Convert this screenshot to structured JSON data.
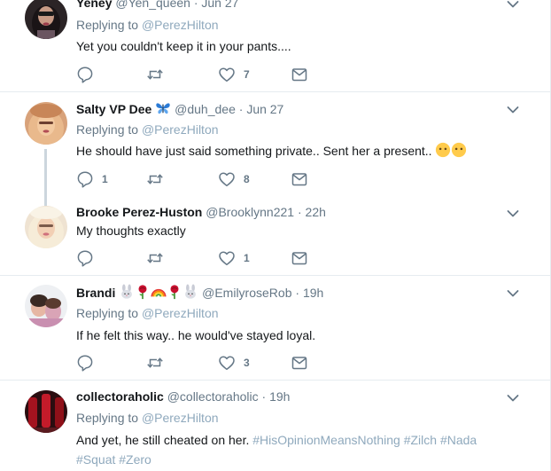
{
  "tweets": [
    {
      "name": "Yeney",
      "handle": "@Yen_queen",
      "time": "Jun 27",
      "replying_prefix": "Replying to",
      "replying_handle": "@PerezHilton",
      "text": "Yet you couldn't keep it in your pants....",
      "replies": "",
      "likes": "7"
    },
    {
      "name": "Salty VP Dee",
      "handle": "@duh_dee",
      "time": "Jun 27",
      "replying_prefix": "Replying to",
      "replying_handle": "@PerezHilton",
      "text": "He should have just said something private.. Sent her a present..",
      "replies": "1",
      "likes": "8",
      "name_emoji": [
        "butterfly"
      ],
      "text_emoji": [
        "no-mouth-face",
        "no-mouth-face"
      ]
    },
    {
      "name": "Brooke Perez-Huston",
      "handle": "@Brooklynn221",
      "time": "22h",
      "text": "My thoughts exactly",
      "replies": "",
      "likes": "1"
    },
    {
      "name": "Brandi",
      "handle": "@EmilyroseRob",
      "time": "19h",
      "replying_prefix": "Replying to",
      "replying_handle": "@PerezHilton",
      "text": "If he felt this way.. he would've stayed loyal.",
      "replies": "",
      "likes": "3",
      "name_emoji": [
        "rabbit",
        "rose",
        "rainbow",
        "rose",
        "rabbit"
      ]
    },
    {
      "name": "collectoraholic",
      "handle": "@collectoraholic",
      "time": "19h",
      "replying_prefix": "Replying to",
      "replying_handle": "@PerezHilton",
      "text": "And yet, he still cheated on her.",
      "hashtags": [
        "#HisOpinionMeansNothing",
        "#Zilch",
        "#Nada",
        "#Squat",
        "#Zero"
      ]
    }
  ],
  "separator": "·",
  "colors": {
    "text": "#14171a",
    "secondary": "#657786",
    "link": "#8fa9bd",
    "border": "#e6ecf0"
  },
  "icons": [
    "reply-icon",
    "retweet-icon",
    "like-icon",
    "dm-icon",
    "chevron-down-icon"
  ]
}
